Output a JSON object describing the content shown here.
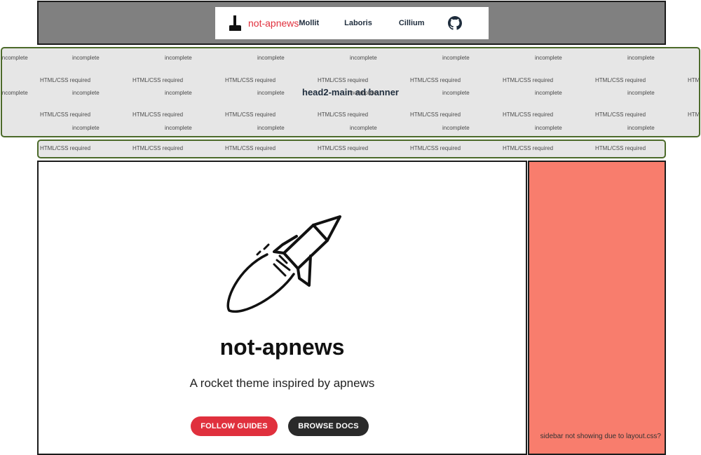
{
  "header": {
    "brand_name": "not-apnews",
    "nav": [
      "Mollit",
      "Laboris",
      "Cillium"
    ]
  },
  "ads": {
    "main_banner_title": "head2-main ad banner",
    "placeholder_incomplete": "incomplete",
    "placeholder_required": "HTML/CSS required"
  },
  "hero": {
    "title": "not-apnews",
    "subtitle": "A rocket theme inspired by apnews",
    "primary_button": "FOLLOW GUIDES",
    "secondary_button": "BROWSE DOCS"
  },
  "sidebar": {
    "note": "sidebar not showing due to layout.css?"
  },
  "colors": {
    "brand_red": "#e0303d",
    "header_bg": "#808080",
    "banner_bg": "#e6e6e6",
    "banner_border": "#4c6a2a",
    "sidebar_bg": "#f87d6d",
    "dark_button": "#2a2a2a"
  },
  "icons": {
    "brand": "boot-logo-icon",
    "github": "github-icon",
    "hero": "rocket-illustration"
  }
}
